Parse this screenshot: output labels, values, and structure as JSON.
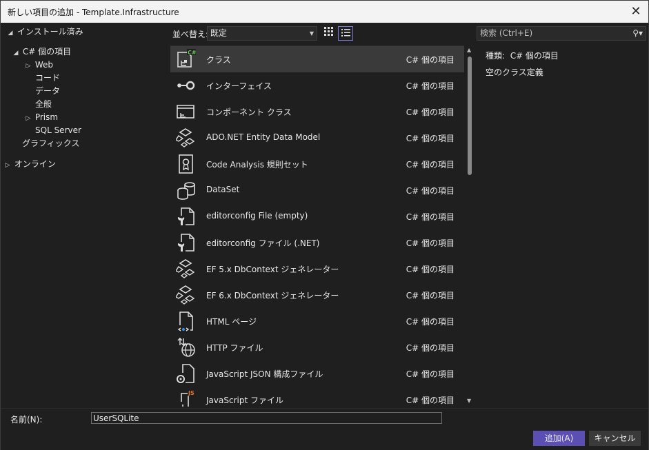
{
  "window": {
    "title": "新しい項目の追加 - Template.Infrastructure",
    "close": "✕"
  },
  "tree": {
    "installed": "インストール済み",
    "csharp": "C# 個の項目",
    "web": "Web",
    "code": "コード",
    "data": "データ",
    "general": "全般",
    "prism": "Prism",
    "sqlserver": "SQL Server",
    "graphics": "グラフィックス",
    "online": "オンライン"
  },
  "toolbar": {
    "sort_label": "並べ替え:",
    "sort_value": "既定",
    "search_placeholder": "検索 (Ctrl+E)"
  },
  "items": [
    {
      "name": "クラス",
      "category": "C# 個の項目",
      "icon": "class-icon"
    },
    {
      "name": "インターフェイス",
      "category": "C# 個の項目",
      "icon": "interface-icon"
    },
    {
      "name": "コンポーネント クラス",
      "category": "C# 個の項目",
      "icon": "component-icon"
    },
    {
      "name": "ADO.NET Entity Data Model",
      "category": "C# 個の項目",
      "icon": "entity-model-icon"
    },
    {
      "name": "Code Analysis 規則セット",
      "category": "C# 個の項目",
      "icon": "ruleset-icon"
    },
    {
      "name": "DataSet",
      "category": "C# 個の項目",
      "icon": "dataset-icon"
    },
    {
      "name": "editorconfig File (empty)",
      "category": "C# 個の項目",
      "icon": "editorconfig-icon"
    },
    {
      "name": "editorconfig ファイル (.NET)",
      "category": "C# 個の項目",
      "icon": "editorconfig-icon"
    },
    {
      "name": "EF 5.x DbContext ジェネレーター",
      "category": "C# 個の項目",
      "icon": "entity-model-icon"
    },
    {
      "name": "EF 6.x DbContext ジェネレーター",
      "category": "C# 個の項目",
      "icon": "entity-model-icon"
    },
    {
      "name": "HTML ページ",
      "category": "C# 個の項目",
      "icon": "html-page-icon"
    },
    {
      "name": "HTTP ファイル",
      "category": "C# 個の項目",
      "icon": "http-file-icon"
    },
    {
      "name": "JavaScript JSON 構成ファイル",
      "category": "C# 個の項目",
      "icon": "json-config-icon"
    },
    {
      "name": "JavaScript ファイル",
      "category": "C# 個の項目",
      "icon": "javascript-file-icon"
    }
  ],
  "details": {
    "type_label": "種類:",
    "type_value": "C# 個の項目",
    "description": "空のクラス定義"
  },
  "bottom": {
    "name_label": "名前(N):",
    "name_value": "UserSQLite",
    "add_button": "追加(A)",
    "cancel_button": "キャンセル"
  },
  "colors": {
    "accent": "#5c4fb3",
    "selection": "#3a3a3a",
    "csharp_badge": "#6ac15b",
    "js_badge": "#e8702a"
  }
}
